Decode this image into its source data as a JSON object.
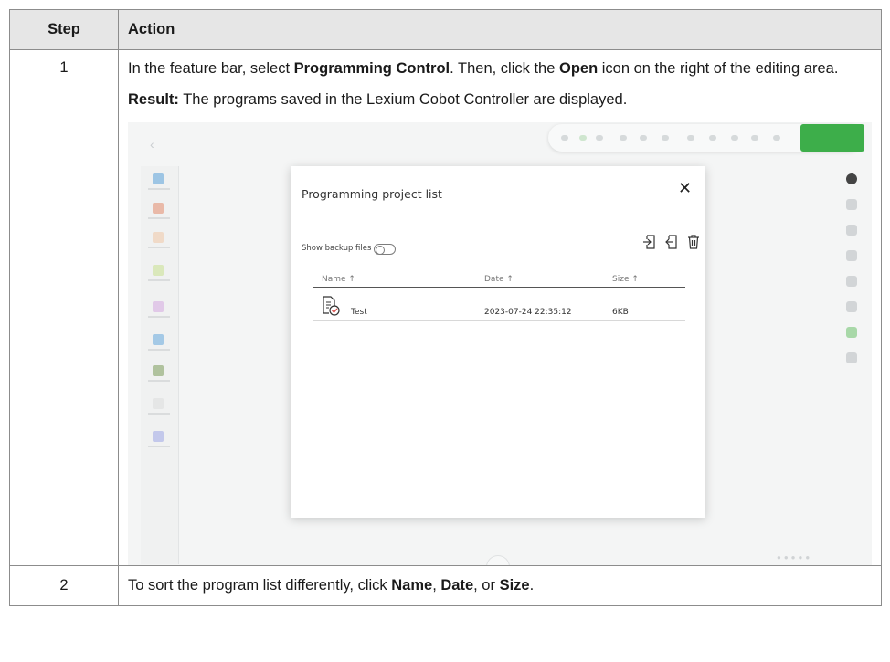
{
  "table": {
    "headers": {
      "step": "Step",
      "action": "Action"
    },
    "rows": [
      {
        "step": "1",
        "action_parts": {
          "p1a": "In the feature bar, select ",
          "p1b": "Programming Control",
          "p1c": ". Then, click the ",
          "p1d": "Open",
          "p1e": " icon on the right of the editing area.",
          "result_label": "Result:",
          "result_text": " The programs saved in the Lexium Cobot Controller are displayed."
        }
      },
      {
        "step": "2",
        "action_parts": {
          "a": "To sort the program list differently, click ",
          "b": "Name",
          "c": ", ",
          "d": "Date",
          "e": ", or ",
          "f": "Size",
          "g": "."
        }
      }
    ]
  },
  "screenshot": {
    "dialog": {
      "title": "Programming project list",
      "close_icon": "close-icon",
      "backup_label": "Show backup files",
      "backup_toggle": "off",
      "action_icons": [
        "import-icon",
        "export-icon",
        "trash-icon"
      ],
      "columns": [
        "Name ↑",
        "Date ↑",
        "Size ↑"
      ],
      "files": [
        {
          "icon": "program-file-icon",
          "name": "Test",
          "date": "2023-07-24 22:35:12",
          "size": "6KB"
        }
      ]
    },
    "colors": {
      "accent_green": "#3dae4a",
      "file_check_red": "#d9534f"
    }
  }
}
